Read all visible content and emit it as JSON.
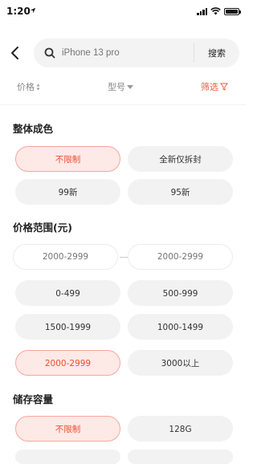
{
  "status": {
    "time": "1:20"
  },
  "search": {
    "placeholder": "iPhone 13 pro",
    "button_label": "搜索"
  },
  "filters": {
    "price": "价格",
    "model": "型号",
    "screen": "筛选"
  },
  "condition": {
    "title": "整体成色",
    "options": [
      {
        "label": "不限制",
        "selected": true
      },
      {
        "label": "全新仅拆封",
        "selected": false
      },
      {
        "label": "99新",
        "selected": false
      },
      {
        "label": "95新",
        "selected": false
      }
    ]
  },
  "price_range": {
    "title": "价格范围(元)",
    "min_placeholder": "2000-2999",
    "max_placeholder": "2000-2999",
    "options": [
      {
        "label": "0-499",
        "selected": false
      },
      {
        "label": "500-999",
        "selected": false
      },
      {
        "label": "1500-1999",
        "selected": false
      },
      {
        "label": "1000-1499",
        "selected": false
      },
      {
        "label": "2000-2999",
        "selected": true
      },
      {
        "label": "3000以上",
        "selected": false
      }
    ]
  },
  "storage": {
    "title": "储存容量",
    "options": [
      {
        "label": "不限制",
        "selected": true
      },
      {
        "label": "128G",
        "selected": false
      }
    ]
  },
  "colors": {
    "accent": "#ee4e34",
    "chip_bg": "#f2f2f2",
    "chip_selected_bg": "#fde9e6"
  }
}
